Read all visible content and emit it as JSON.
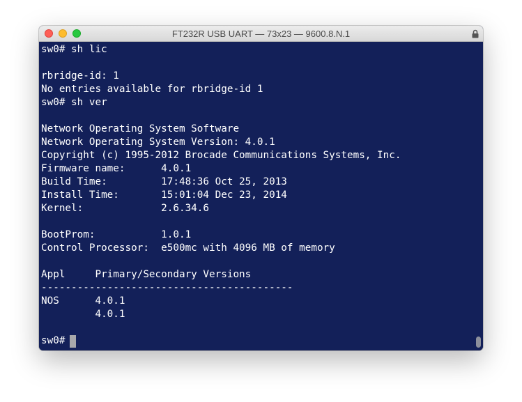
{
  "window": {
    "title": "FT232R USB UART — 73x23 — 9600.8.N.1"
  },
  "terminal": {
    "lines": [
      "sw0# sh lic",
      "",
      "rbridge-id: 1",
      "No entries available for rbridge-id 1",
      "sw0# sh ver",
      "",
      "Network Operating System Software",
      "Network Operating System Version: 4.0.1",
      "Copyright (c) 1995-2012 Brocade Communications Systems, Inc.",
      "Firmware name:      4.0.1",
      "Build Time:         17:48:36 Oct 25, 2013",
      "Install Time:       15:01:04 Dec 23, 2014",
      "Kernel:             2.6.34.6",
      "",
      "BootProm:           1.0.1",
      "Control Processor:  e500mc with 4096 MB of memory",
      "",
      "Appl     Primary/Secondary Versions",
      "------------------------------------------",
      "NOS      4.0.1",
      "         4.0.1",
      "",
      "sw0# "
    ]
  },
  "colors": {
    "terminal_background": "#132059",
    "terminal_text": "#ffffff",
    "cursor": "#a8a8ab"
  }
}
